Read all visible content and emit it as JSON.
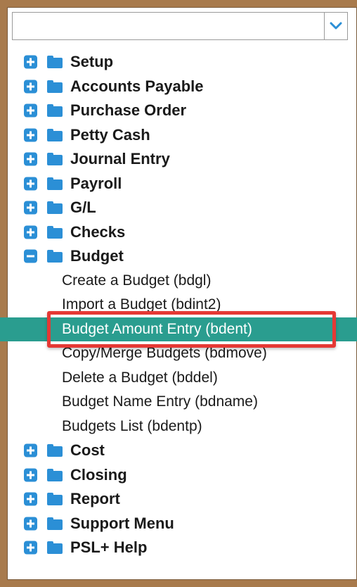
{
  "dropdown": {
    "value": "",
    "icon": "chevron-down-icon"
  },
  "tree": {
    "top_categories": [
      {
        "label": "Setup"
      },
      {
        "label": "Accounts Payable"
      },
      {
        "label": "Purchase Order"
      },
      {
        "label": "Petty Cash"
      },
      {
        "label": "Journal Entry"
      },
      {
        "label": "Payroll"
      },
      {
        "label": "G/L"
      },
      {
        "label": "Checks"
      }
    ],
    "expanded": {
      "label": "Budget",
      "items": [
        {
          "label": "Create a Budget (bdgl)"
        },
        {
          "label": "Import a Budget (bdint2)"
        },
        {
          "label": "Budget Amount Entry (bdent)",
          "selected": true
        },
        {
          "label": "Copy/Merge Budgets (bdmove)"
        },
        {
          "label": "Delete a Budget (bddel)"
        },
        {
          "label": "Budget Name Entry (bdname)"
        },
        {
          "label": "Budgets List (bdentp)"
        }
      ]
    },
    "bottom_categories": [
      {
        "label": "Cost"
      },
      {
        "label": "Closing"
      },
      {
        "label": "Report"
      },
      {
        "label": "Support Menu"
      },
      {
        "label": "PSL+ Help"
      }
    ]
  },
  "colors": {
    "background": "#a87a4c",
    "accent_blue": "#2b8fd6",
    "selected_row": "#2a9d8f",
    "highlight_border": "#e53935"
  }
}
